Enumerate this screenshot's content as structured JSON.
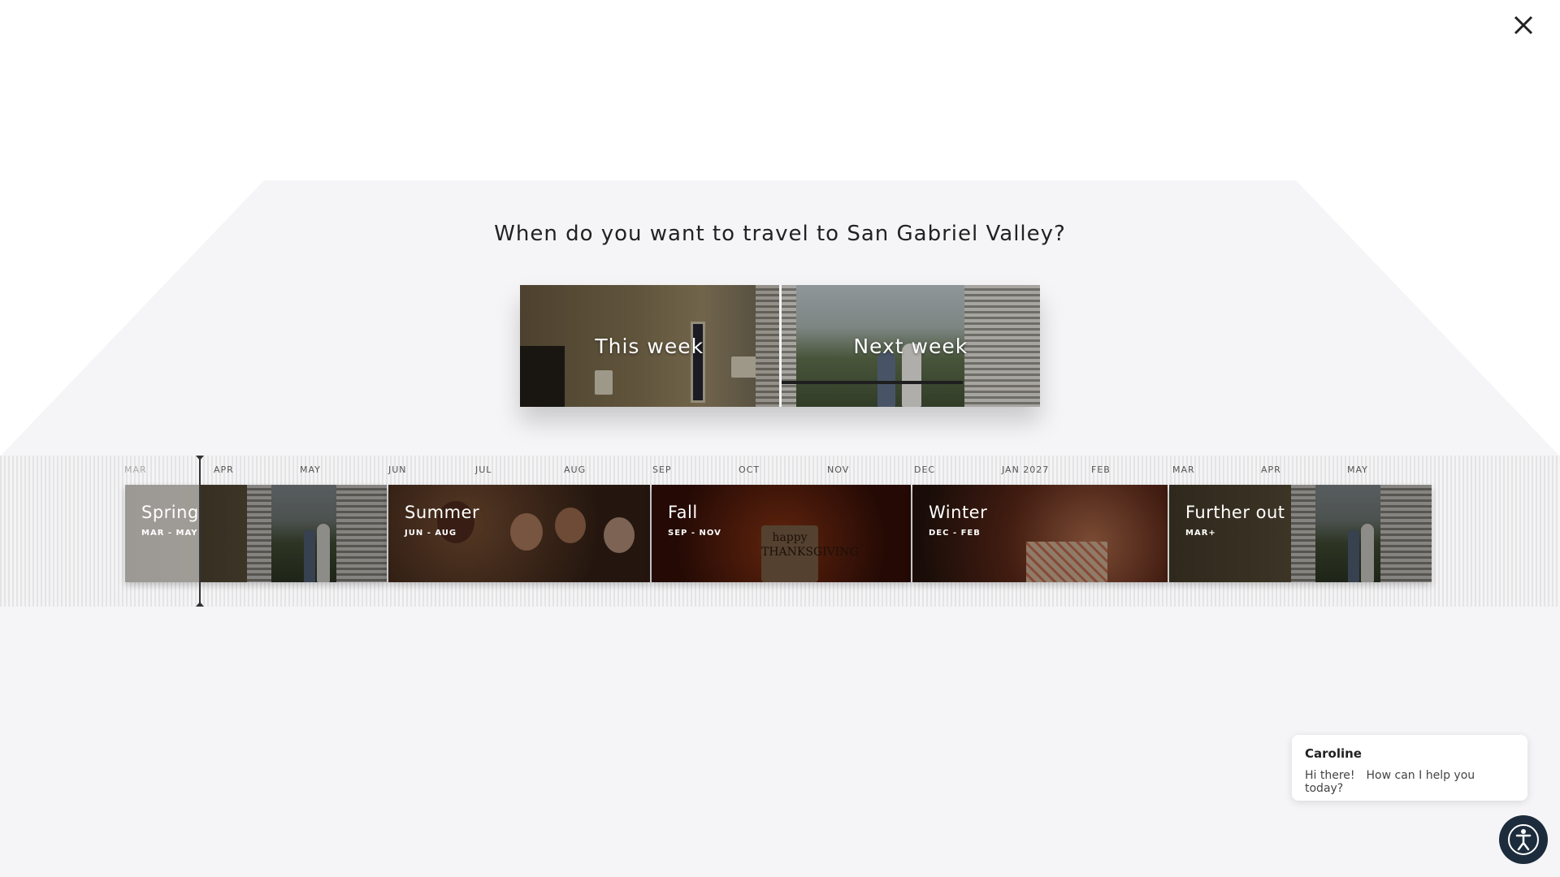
{
  "dialog": {
    "question": "When do you want to travel to San Gabriel Valley?",
    "close_icon": "close-icon"
  },
  "quick_options": [
    {
      "label": "This week"
    },
    {
      "label": "Next week"
    }
  ],
  "timeline": {
    "months": [
      "MAR",
      "APR",
      "MAY",
      "JUN",
      "JUL",
      "AUG",
      "SEP",
      "OCT",
      "NOV",
      "DEC",
      "JAN 2027",
      "FEB",
      "MAR",
      "APR",
      "MAY"
    ],
    "seasons": [
      {
        "name": "Spring",
        "range": "MAR - MAY"
      },
      {
        "name": "Summer",
        "range": "JUN - AUG"
      },
      {
        "name": "Fall",
        "range": "SEP - NOV"
      },
      {
        "name": "Winter",
        "range": "DEC - FEB"
      },
      {
        "name": "Further out",
        "range": "MAR+"
      }
    ]
  },
  "chat": {
    "agent": "Caroline",
    "greeting": "Hi there!",
    "prompt": "How can I help you today?"
  },
  "colors": {
    "panel_bg": "#f5f5f7",
    "accessibility_button": "#1c2c3c"
  },
  "icons": {
    "accessibility": "accessibility-icon",
    "close": "close-icon"
  }
}
